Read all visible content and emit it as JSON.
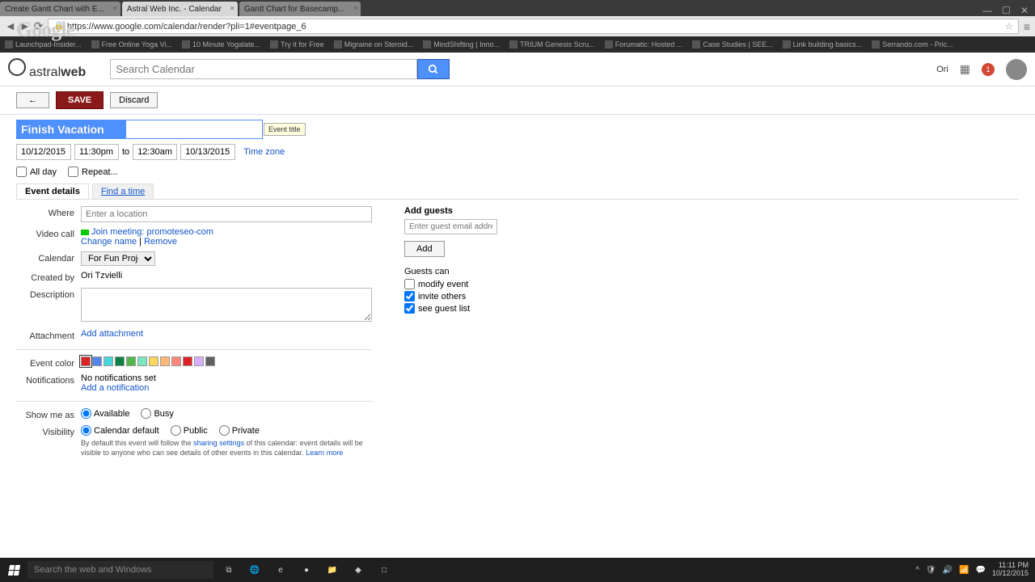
{
  "browser": {
    "tabs": [
      {
        "label": "Create Gantt Chart with E..."
      },
      {
        "label": "Astral Web Inc. - Calendar",
        "active": true
      },
      {
        "label": "Gantt Chart for Basecamp..."
      }
    ],
    "url": "https://www.google.com/calendar/render?pli=1#eventpage_6"
  },
  "bookmarks": [
    "Launchpad-Insider...",
    "Free Online Yoga Vi...",
    "10 Minute Yogalate...",
    "Try it for Free",
    "Migraine on Steroid...",
    "MindShifting | Inno...",
    "TRIUM Genesis Scru...",
    "Forumatic: Hosted ...",
    "Case Studies | SEE...",
    "Link building basics...",
    "Serrando.com - Pric..."
  ],
  "header": {
    "logo": "astralweb",
    "search_placeholder": "Search Calendar",
    "user_badge": "Ori",
    "notif_count": "1"
  },
  "actions": {
    "back": "←",
    "save": "SAVE",
    "discard": "Discard"
  },
  "event": {
    "title": "Finish Vacation",
    "title_tooltip": "Event title",
    "date_from": "10/12/2015",
    "time_from": "11:30pm",
    "to": "to",
    "time_to": "12:30am",
    "date_to": "10/13/2015",
    "timezone_link": "Time zone",
    "all_day": "All day",
    "repeat": "Repeat...",
    "tabs": {
      "details": "Event details",
      "findtime": "Find a time"
    }
  },
  "details": {
    "where_label": "Where",
    "where_placeholder": "Enter a location",
    "video_label": "Video call",
    "video_join": "Join meeting: promoteseo-com",
    "video_change": "Change name",
    "video_remove": "Remove",
    "calendar_label": "Calendar",
    "calendar_value": "For Fun Project",
    "createdby_label": "Created by",
    "createdby_value": "Ori Tzvielli",
    "description_label": "Description",
    "attachment_label": "Attachment",
    "attachment_link": "Add attachment",
    "color_label": "Event color",
    "colors": [
      "#dc2127",
      "#5484ed",
      "#46d6db",
      "#0b8043",
      "#51b749",
      "#7ae7bf",
      "#fbd75b",
      "#ffb878",
      "#ff887c",
      "#dc2127",
      "#dbadff",
      "#616161"
    ],
    "notif_label": "Notifications",
    "notif_none": "No notifications set",
    "notif_add": "Add a notification",
    "showme_label": "Show me as",
    "showme_available": "Available",
    "showme_busy": "Busy",
    "visibility_label": "Visibility",
    "vis_default": "Calendar default",
    "vis_public": "Public",
    "vis_private": "Private",
    "note_1": "By default this event will follow the ",
    "note_link1": "sharing settings",
    "note_2": " of this calendar: event details will be visible to anyone who can see details of other events in this calendar. ",
    "note_link2": "Learn more"
  },
  "guests": {
    "header": "Add guests",
    "placeholder": "Enter guest email addresses",
    "add_btn": "Add",
    "can_header": "Guests can",
    "modify": "modify event",
    "invite": "invite others",
    "seelist": "see guest list"
  },
  "taskbar": {
    "search_placeholder": "Search the web and Windows",
    "time": "11:11 PM",
    "date": "10/12/2015"
  }
}
